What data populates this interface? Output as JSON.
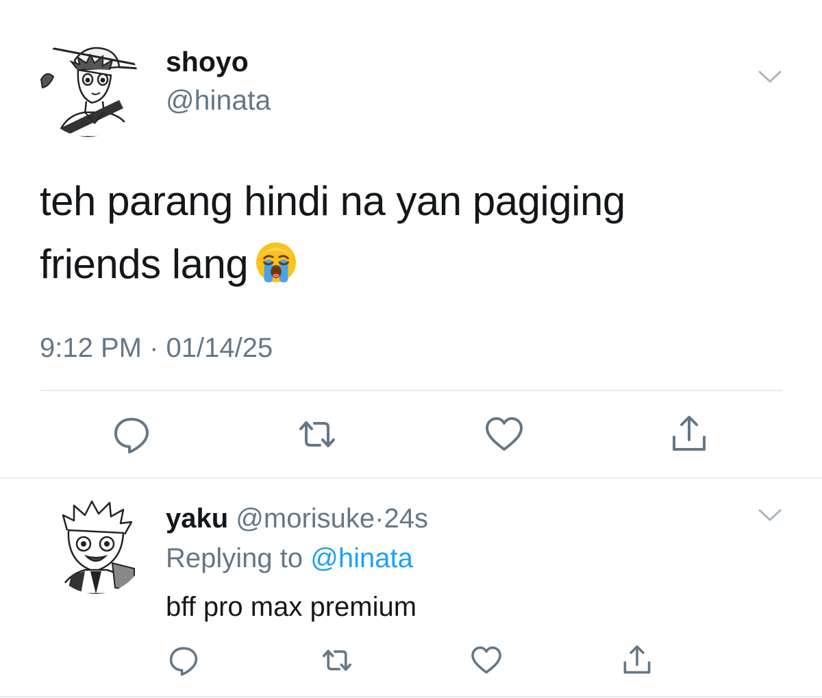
{
  "main_tweet": {
    "author": {
      "display_name": "shoyo",
      "handle": "@hinata"
    },
    "text_line1": "teh parang hindi na yan pagiging",
    "text_line2": "friends lang",
    "emoji": "loudly-crying-face",
    "time": "9:12 PM",
    "separator": "·",
    "date": "01/14/25",
    "actions": [
      "reply-icon",
      "retweet-icon",
      "like-icon",
      "share-icon"
    ]
  },
  "reply": {
    "author": {
      "display_name": "yaku",
      "handle": "@morisuke"
    },
    "separator": "·",
    "age": "24s",
    "replying_to_label": "Replying to",
    "replying_to_handle": "@hinata",
    "text": "bff pro max premium",
    "actions": [
      "reply-icon",
      "retweet-icon",
      "like-icon",
      "share-icon"
    ]
  },
  "colors": {
    "text": "#14171a",
    "secondary": "#657786",
    "link": "#1da1f2",
    "divider": "#e6ecf0",
    "caret": "#aab8c2"
  }
}
